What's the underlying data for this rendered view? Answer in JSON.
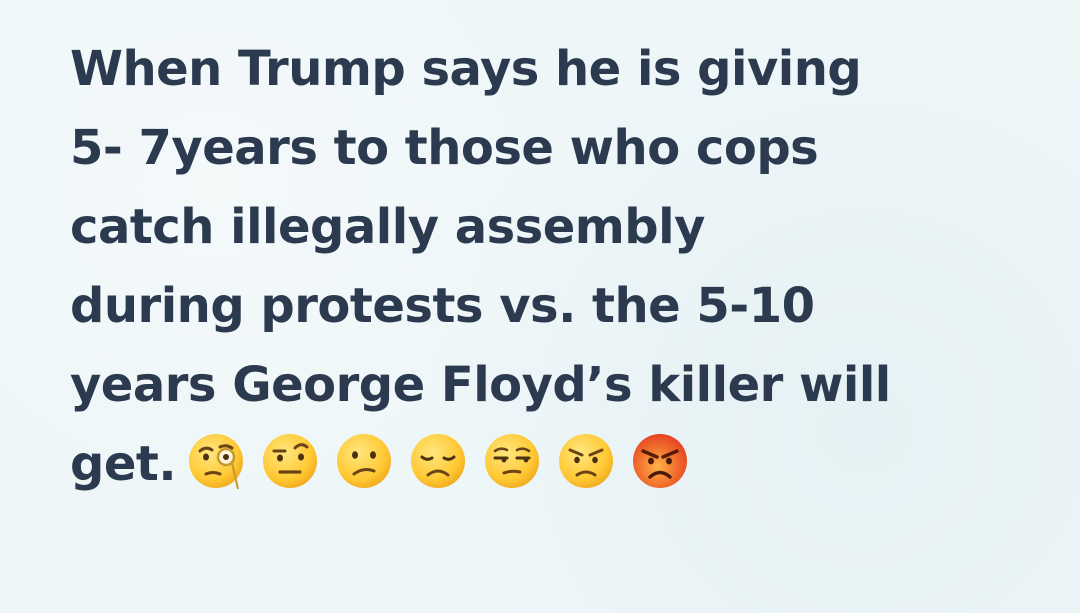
{
  "post": {
    "lines": [
      "When Trump says he is giving",
      "5- 7years to those who cops",
      "catch  illegally assembly",
      "during protests vs. the 5-10",
      "years George Floyd’s killer will",
      "get."
    ]
  },
  "emojis": [
    {
      "name": "face-with-monocle-icon"
    },
    {
      "name": "face-with-raised-eyebrow-icon"
    },
    {
      "name": "confused-face-icon"
    },
    {
      "name": "disappointed-face-icon"
    },
    {
      "name": "unamused-face-icon"
    },
    {
      "name": "angry-face-icon"
    },
    {
      "name": "pouting-face-icon"
    }
  ],
  "colors": {
    "background": "#eef6f8",
    "text": "#2b3a4e",
    "emoji_yellow": "#ffcc33",
    "emoji_red": "#f0452b"
  }
}
